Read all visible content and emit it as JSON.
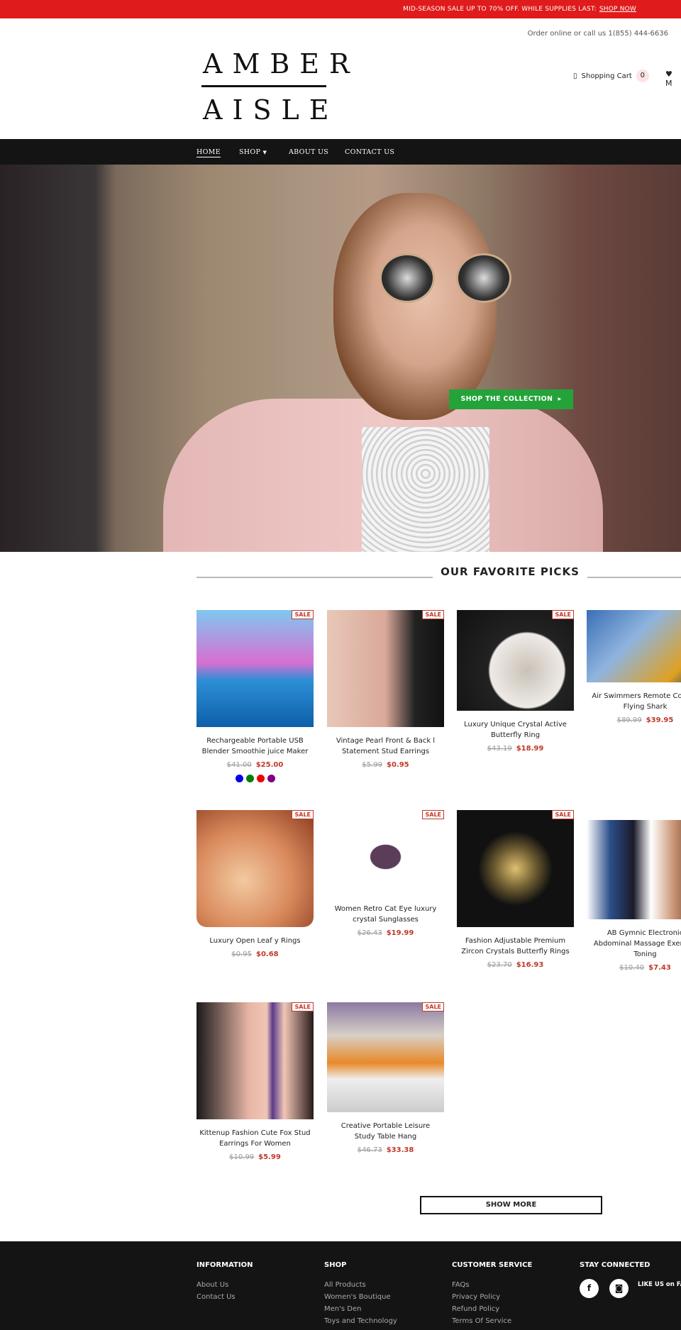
{
  "announcement": {
    "text": "MID-SEASON SALE UP TO 70% OFF. WHILE SUPPLIES LAST:",
    "link": "SHOP NOW"
  },
  "header": {
    "order_text": "Order online or call us 1(855) 444-6636",
    "logo_line1": "AMBER",
    "logo_line2": "AISLE",
    "cart_label": "Shopping Cart",
    "cart_count": "0",
    "wishlist_label": "M"
  },
  "nav": {
    "items": [
      {
        "label": "HOME"
      },
      {
        "label": "SHOP"
      },
      {
        "label": "ABOUT US"
      },
      {
        "label": "CONTACT US"
      }
    ]
  },
  "hero": {
    "cta": "SHOP THE COLLECTION"
  },
  "picks": {
    "title": "OUR FAVORITE PICKS",
    "sale_badge": "SALE",
    "show_more": "SHOW MORE",
    "products": [
      {
        "name": "Rechargeable Portable USB Blender Smoothie juice Maker",
        "old": "$41.00",
        "new": "$25.00",
        "swatches": [
          "#0000ee",
          "#008000",
          "#ee0000",
          "#800080"
        ]
      },
      {
        "name": "Vintage Pearl Front & Back l Statement Stud Earrings",
        "old": "$5.99",
        "new": "$0.95"
      },
      {
        "name": "Luxury Unique Crystal Active Butterfly Ring",
        "old": "$43.19",
        "new": "$18.99"
      },
      {
        "name": "Air Swimmers Remote Control Flying Shark",
        "old": "$89.99",
        "new": "$39.95"
      },
      {
        "name": "Luxury Open Leaf y Rings",
        "old": "$0.95",
        "new": "$0.68"
      },
      {
        "name": "Women Retro Cat Eye luxury crystal Sunglasses",
        "old": "$26.43",
        "new": "$19.99"
      },
      {
        "name": "Fashion Adjustable Premium Zircon Crystals Butterfly Rings",
        "old": "$23.70",
        "new": "$16.93"
      },
      {
        "name": "AB Gymnic Electronic Abdominal Massage Exercise Toning",
        "old": "$10.40",
        "new": "$7.43"
      },
      {
        "name": "Kittenup Fashion Cute Fox Stud Earrings For Women",
        "old": "$10.99",
        "new": "$5.99"
      },
      {
        "name": "Creative Portable Leisure Study Table Hang",
        "old": "$46.73",
        "new": "$33.38"
      }
    ]
  },
  "footer": {
    "information": {
      "title": "INFORMATION",
      "links": [
        "About Us",
        "Contact Us"
      ]
    },
    "shop": {
      "title": "SHOP",
      "links": [
        "All Products",
        "Women's Boutique",
        "Men's Den",
        "Toys and Technology"
      ]
    },
    "service": {
      "title": "CUSTOMER SERVICE",
      "links": [
        "FAQs",
        "Privacy Policy",
        "Refund Policy",
        "Terms Of Service"
      ]
    },
    "connect": {
      "title": "STAY CONNECTED",
      "like_text": "LIKE US on FACEBOOK"
    }
  },
  "colors": {
    "accent": "#e01b1b",
    "cta": "#23a33a",
    "sale": "#c0392b"
  }
}
